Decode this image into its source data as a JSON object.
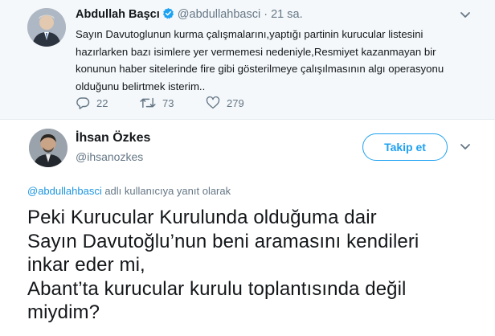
{
  "parent_tweet": {
    "author_name": "Abdullah Başcı",
    "handle": "@abdullahbasci",
    "separator": "·",
    "time": "21 sa.",
    "text_lines": [
      "Sayın Davutoglunun kurma çalışmalarını,yaptığı partinin kurucular listesini",
      "hazırlarken bazı isimlere yer vermemesi nedeniyle,Resmiyet kazanmayan bir",
      "konunun haber sitelerinde fire gibi gösterilmeye çalışılmasının algı operasyonu",
      "olduğunu belirtmek isterim.."
    ],
    "replies": "22",
    "retweets": "73",
    "likes": "279",
    "icons": [
      "verified-badge-icon",
      "chevron-down-icon",
      "reply-icon",
      "retweet-icon",
      "heart-icon"
    ]
  },
  "main_tweet": {
    "author_name": "İhsan Özkes",
    "handle": "@ihsanozkes",
    "follow_label": "Takip et",
    "reply_to_user": "@abdullahbasci",
    "reply_to_suffix": " adlı kullanıcıya yanıt olarak",
    "text_lines": [
      "Peki Kurucular Kurulunda olduğuma dair",
      "Sayın Davutoğlu’nun beni aramasını kendileri",
      "inkar eder mi,",
      "Abant’ta kurucular kurulu toplantısında değil",
      "miydim?"
    ]
  },
  "colors": {
    "accent": "#1da1f2",
    "muted": "#657786",
    "text": "#14171a",
    "parent_bg": "#f5f8fa"
  }
}
